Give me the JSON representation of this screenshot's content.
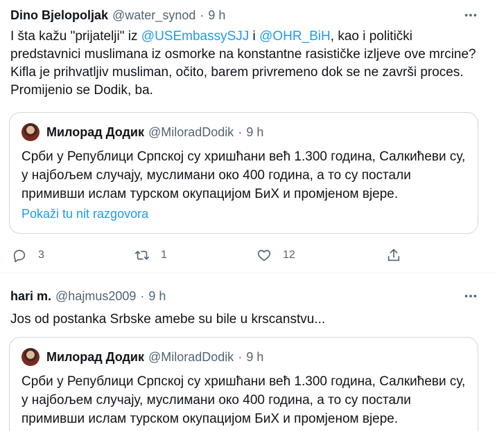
{
  "tweet1": {
    "name": "Dino Bjelopoljak",
    "handle": "@water_synod",
    "dot": "·",
    "time": "9 h",
    "text_parts": {
      "p1": "I šta kažu \"prijatelji\" iz ",
      "m1": "@USEmbassySJJ",
      "p2": " i ",
      "m2": "@OHR_BiH",
      "p3": ", kao i politički predstavnici muslimana iz osmorke na konstantne rasističke izljeve ove mrcine? Kifla je prihvatljiv musliman, očito, barem privremeno dok se ne završi proces. Promijenio se Dodik, ba."
    },
    "quote": {
      "name": "Милорад Додик",
      "handle": "@MiloradDodik",
      "dot": "·",
      "time": "9 h",
      "text": "Срби у Републици Српској су хришћани већ 1.300 година, Салкићеви су, у најбољем случају, муслимани око 400 година, а то су постали примивши ислам турском окупацијом БиХ и промјеном вјере.",
      "show_thread": "Pokaži tu nit razgovora"
    },
    "actions": {
      "replies": "3",
      "retweets": "1",
      "likes": "12"
    }
  },
  "tweet2": {
    "name": "hari m.",
    "handle": "@hajmus2009",
    "dot": "·",
    "time": "9 h",
    "text": "Jos od postanka Srbske amebe su bile u krscanstvu...",
    "quote": {
      "name": "Милорад Додик",
      "handle": "@MiloradDodik",
      "dot": "·",
      "time": "9 h",
      "text": "Срби у Републици Српској су хришћани већ 1.300 година, Салкићеви су, у најбољем случају, муслимани око 400 година, а то су постали примивши ислам турском окупацијом БиХ и промјеном вјере."
    }
  },
  "icons": {
    "more": "more-horizontal-icon",
    "reply": "reply-icon",
    "retweet": "retweet-icon",
    "like": "heart-icon",
    "share": "share-icon"
  },
  "colors": {
    "link": "#1d9bf0",
    "secondary": "#536471",
    "text": "#0f1419",
    "border": "#cfd9de"
  }
}
